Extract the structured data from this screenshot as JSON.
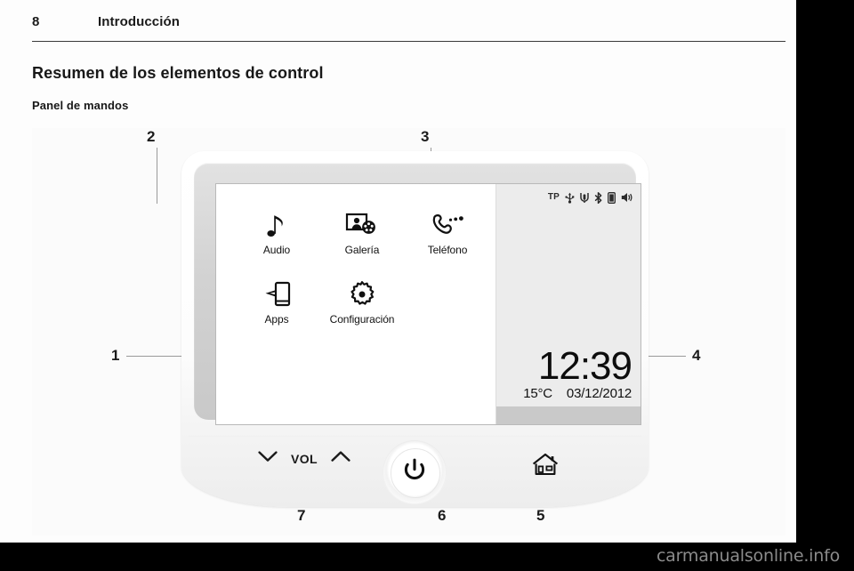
{
  "page": {
    "number": "8",
    "chapter": "Introducción",
    "section_heading": "Resumen de los elementos de control",
    "subsection_heading": "Panel de mandos",
    "watermark": "carmanualsonline.info",
    "background_color": "#000000",
    "sheet_color": "#fdfdfd"
  },
  "figure": {
    "name": "panel-de-mandos-diagram",
    "callouts": [
      {
        "id": "1",
        "label": "1",
        "target": "pantalla"
      },
      {
        "id": "2",
        "label": "2",
        "target": "menu-inicio"
      },
      {
        "id": "3",
        "label": "3",
        "target": "barra-de-estado"
      },
      {
        "id": "4",
        "label": "4",
        "target": "reloj"
      },
      {
        "id": "5",
        "label": "5",
        "target": "boton-inicio"
      },
      {
        "id": "6",
        "label": "6",
        "target": "boton-encendido"
      },
      {
        "id": "7",
        "label": "7",
        "target": "control-volumen"
      }
    ]
  },
  "device": {
    "screen": {
      "status_bar": {
        "tp_label": "TP",
        "icons": [
          "tp-label",
          "usb-icon",
          "mute-microphone-icon",
          "bluetooth-icon",
          "phone-battery-icon",
          "speaker-mute-icon"
        ]
      },
      "apps": [
        {
          "label": "Audio",
          "icon": "music-note-icon"
        },
        {
          "label": "Galería",
          "icon": "photo-film-icon"
        },
        {
          "label": "Teléfono",
          "icon": "phone-handset-icon"
        },
        {
          "label": "Apps",
          "icon": "smartphone-hand-icon"
        },
        {
          "label": "Configuración",
          "icon": "gear-icon"
        }
      ],
      "clock": {
        "time": "12:39",
        "temperature": "15°C",
        "date": "03/12/2012"
      },
      "colors": {
        "main_panel": "#ffffff",
        "side_panel": "#ececec",
        "side_footer": "#c9c9c9",
        "text": "#111111"
      }
    },
    "controls": {
      "volume_down_icon": "chevron-down-icon",
      "volume_label": "VOL",
      "volume_up_icon": "chevron-up-icon",
      "power_icon": "power-icon",
      "home_icon": "home-icon"
    }
  }
}
